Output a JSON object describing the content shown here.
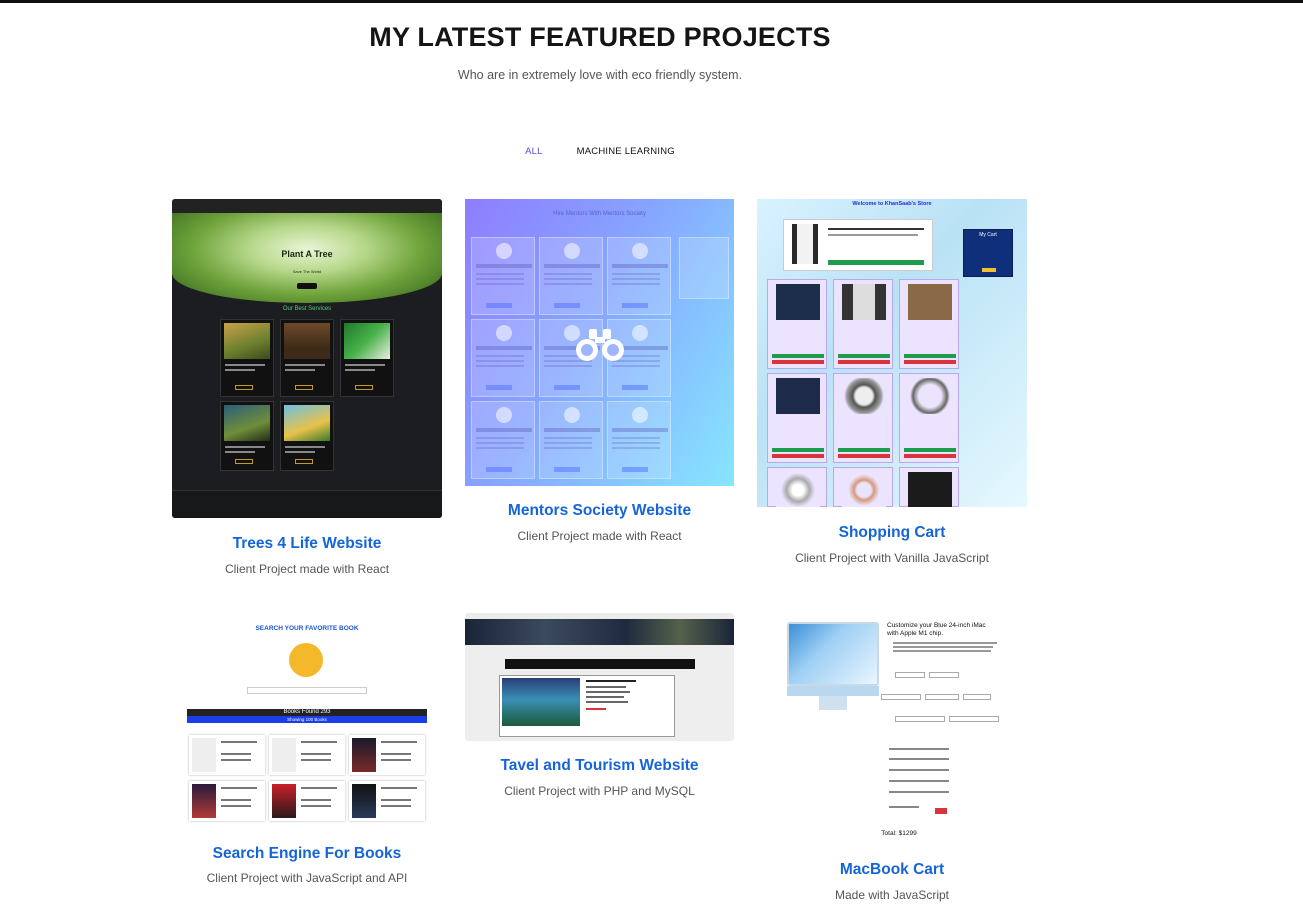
{
  "section": {
    "title": "MY LATEST FEATURED PROJECTS",
    "subtitle": "Who are in extremely love with eco friendly system."
  },
  "filters": [
    {
      "label": "ALL",
      "active": true
    },
    {
      "label": "MACHINE LEARNING",
      "active": false
    }
  ],
  "projects": [
    {
      "title": "Trees 4 Life Website",
      "subtitle": "Client Project made with React",
      "preview": {
        "hero_title": "Plant A Tree",
        "hero_sub": "Save The World",
        "services_heading": "Our Best Services"
      }
    },
    {
      "title": "Mentors Society Website",
      "subtitle": "Client Project made with React",
      "preview": {
        "header": "Hire Mentors With Mentors Society"
      }
    },
    {
      "title": "Shopping Cart",
      "subtitle": "Client Project with Vanilla JavaScript",
      "preview": {
        "header": "Welcome to KhanSaab's Store",
        "cart_label": "My Cart"
      }
    },
    {
      "title": "Search Engine For Books",
      "subtitle": "Client Project with JavaScript and API",
      "preview": {
        "header": "SEARCH YOUR FAVORITE BOOK",
        "found": "Books Found 293",
        "showing": "Showing 100 Books"
      }
    },
    {
      "title": "Tavel and Tourism Website",
      "subtitle": "Client Project with PHP and MySQL",
      "preview": {}
    },
    {
      "title": "MacBook Cart",
      "subtitle": "Made with JavaScript",
      "preview": {
        "headline": "Customize your Blue 24-inch iMac with Apple M1 chip.",
        "total": "Total: $1299"
      }
    }
  ],
  "colors": {
    "accent_title": "#1565d8",
    "filter_active": "#5a4fd8"
  }
}
